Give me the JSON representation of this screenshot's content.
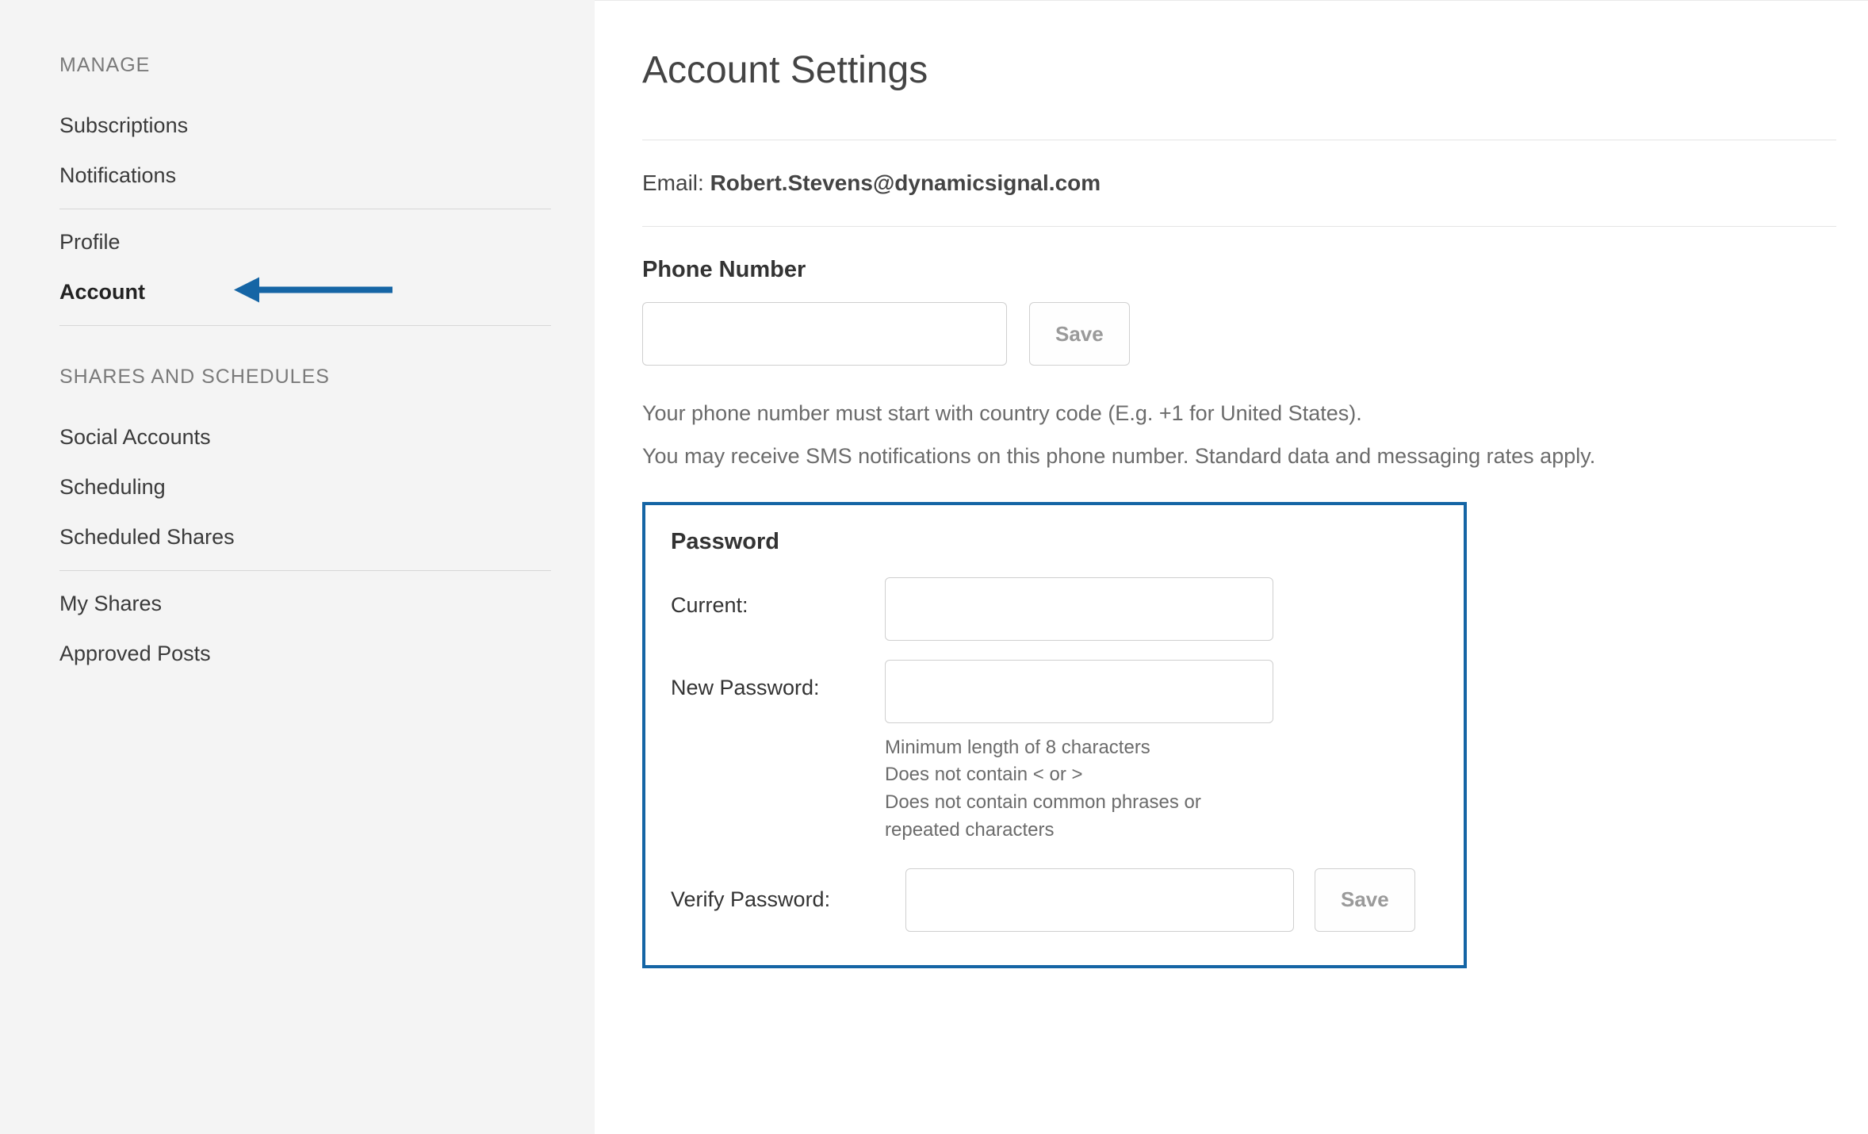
{
  "sidebar": {
    "header1": "MANAGE",
    "items1": [
      {
        "label": "Subscriptions"
      },
      {
        "label": "Notifications"
      }
    ],
    "items2": [
      {
        "label": "Profile"
      },
      {
        "label": "Account"
      }
    ],
    "header2": "SHARES AND SCHEDULES",
    "items3": [
      {
        "label": "Social Accounts"
      },
      {
        "label": "Scheduling"
      },
      {
        "label": "Scheduled Shares"
      }
    ],
    "items4": [
      {
        "label": "My Shares"
      },
      {
        "label": "Approved Posts"
      }
    ]
  },
  "main": {
    "title": "Account Settings",
    "email_label": "Email: ",
    "email_value": "Robert.Stevens@dynamicsignal.com",
    "phone": {
      "label": "Phone Number",
      "value": "",
      "save_label": "Save",
      "hint1": "Your phone number must start with country code (E.g. +1 for United States).",
      "hint2": "You may receive SMS notifications on this phone number. Standard data and messaging rates apply."
    },
    "password": {
      "header": "Password",
      "current_label": "Current:",
      "current_value": "",
      "new_label": "New Password:",
      "new_value": "",
      "rules": [
        "Minimum length of 8 characters",
        "Does not contain < or >",
        "Does not contain common phrases or repeated characters"
      ],
      "verify_label": "Verify Password:",
      "verify_value": "",
      "save_label": "Save"
    }
  },
  "colors": {
    "highlight_border": "#1565a5",
    "arrow": "#1565a5"
  }
}
